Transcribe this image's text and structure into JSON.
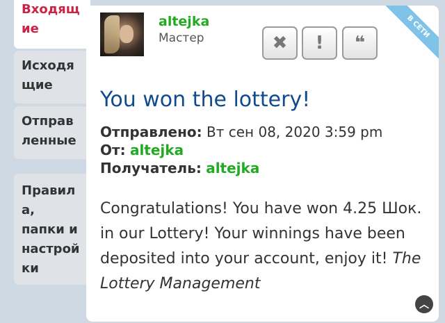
{
  "sidebar": {
    "items": [
      {
        "label": "Входящие",
        "active": true
      },
      {
        "label": "Исходящие"
      },
      {
        "label": "Отправленные"
      },
      {
        "label": "Правила, папки и настройки"
      }
    ]
  },
  "post": {
    "author": "altejka",
    "rank": "Мастер",
    "status_ribbon": "В СЕТИ",
    "subject": "You won the lottery!",
    "meta": {
      "sent_label": "Отправлено:",
      "sent_value": "Вт сен 08, 2020 3:59 pm",
      "from_label": "От:",
      "from_value": "altejka",
      "to_label": "Получатель:",
      "to_value": "altejka"
    },
    "body": "Congratulations! You have won 4.25 Шок. in our Lottery! Your winnings have been deposited into your account, enjoy it!",
    "signature": "The Lottery Management"
  },
  "buttons": {
    "delete_icon": "✖",
    "report_icon": "!",
    "quote_icon": "❝"
  },
  "colors": {
    "accent": "#114b8f",
    "user": "#22aa22",
    "active_tab": "#cc2244",
    "ribbon": "#7fc3e8"
  }
}
